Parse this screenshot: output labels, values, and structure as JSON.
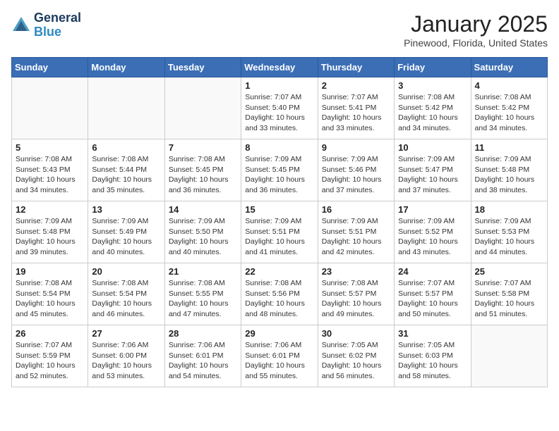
{
  "header": {
    "logo_line1": "General",
    "logo_line2": "Blue",
    "month": "January 2025",
    "location": "Pinewood, Florida, United States"
  },
  "days_of_week": [
    "Sunday",
    "Monday",
    "Tuesday",
    "Wednesday",
    "Thursday",
    "Friday",
    "Saturday"
  ],
  "weeks": [
    [
      {
        "day": "",
        "info": ""
      },
      {
        "day": "",
        "info": ""
      },
      {
        "day": "",
        "info": ""
      },
      {
        "day": "1",
        "info": "Sunrise: 7:07 AM\nSunset: 5:40 PM\nDaylight: 10 hours\nand 33 minutes."
      },
      {
        "day": "2",
        "info": "Sunrise: 7:07 AM\nSunset: 5:41 PM\nDaylight: 10 hours\nand 33 minutes."
      },
      {
        "day": "3",
        "info": "Sunrise: 7:08 AM\nSunset: 5:42 PM\nDaylight: 10 hours\nand 34 minutes."
      },
      {
        "day": "4",
        "info": "Sunrise: 7:08 AM\nSunset: 5:42 PM\nDaylight: 10 hours\nand 34 minutes."
      }
    ],
    [
      {
        "day": "5",
        "info": "Sunrise: 7:08 AM\nSunset: 5:43 PM\nDaylight: 10 hours\nand 34 minutes."
      },
      {
        "day": "6",
        "info": "Sunrise: 7:08 AM\nSunset: 5:44 PM\nDaylight: 10 hours\nand 35 minutes."
      },
      {
        "day": "7",
        "info": "Sunrise: 7:08 AM\nSunset: 5:45 PM\nDaylight: 10 hours\nand 36 minutes."
      },
      {
        "day": "8",
        "info": "Sunrise: 7:09 AM\nSunset: 5:45 PM\nDaylight: 10 hours\nand 36 minutes."
      },
      {
        "day": "9",
        "info": "Sunrise: 7:09 AM\nSunset: 5:46 PM\nDaylight: 10 hours\nand 37 minutes."
      },
      {
        "day": "10",
        "info": "Sunrise: 7:09 AM\nSunset: 5:47 PM\nDaylight: 10 hours\nand 37 minutes."
      },
      {
        "day": "11",
        "info": "Sunrise: 7:09 AM\nSunset: 5:48 PM\nDaylight: 10 hours\nand 38 minutes."
      }
    ],
    [
      {
        "day": "12",
        "info": "Sunrise: 7:09 AM\nSunset: 5:48 PM\nDaylight: 10 hours\nand 39 minutes."
      },
      {
        "day": "13",
        "info": "Sunrise: 7:09 AM\nSunset: 5:49 PM\nDaylight: 10 hours\nand 40 minutes."
      },
      {
        "day": "14",
        "info": "Sunrise: 7:09 AM\nSunset: 5:50 PM\nDaylight: 10 hours\nand 40 minutes."
      },
      {
        "day": "15",
        "info": "Sunrise: 7:09 AM\nSunset: 5:51 PM\nDaylight: 10 hours\nand 41 minutes."
      },
      {
        "day": "16",
        "info": "Sunrise: 7:09 AM\nSunset: 5:51 PM\nDaylight: 10 hours\nand 42 minutes."
      },
      {
        "day": "17",
        "info": "Sunrise: 7:09 AM\nSunset: 5:52 PM\nDaylight: 10 hours\nand 43 minutes."
      },
      {
        "day": "18",
        "info": "Sunrise: 7:09 AM\nSunset: 5:53 PM\nDaylight: 10 hours\nand 44 minutes."
      }
    ],
    [
      {
        "day": "19",
        "info": "Sunrise: 7:08 AM\nSunset: 5:54 PM\nDaylight: 10 hours\nand 45 minutes."
      },
      {
        "day": "20",
        "info": "Sunrise: 7:08 AM\nSunset: 5:54 PM\nDaylight: 10 hours\nand 46 minutes."
      },
      {
        "day": "21",
        "info": "Sunrise: 7:08 AM\nSunset: 5:55 PM\nDaylight: 10 hours\nand 47 minutes."
      },
      {
        "day": "22",
        "info": "Sunrise: 7:08 AM\nSunset: 5:56 PM\nDaylight: 10 hours\nand 48 minutes."
      },
      {
        "day": "23",
        "info": "Sunrise: 7:08 AM\nSunset: 5:57 PM\nDaylight: 10 hours\nand 49 minutes."
      },
      {
        "day": "24",
        "info": "Sunrise: 7:07 AM\nSunset: 5:57 PM\nDaylight: 10 hours\nand 50 minutes."
      },
      {
        "day": "25",
        "info": "Sunrise: 7:07 AM\nSunset: 5:58 PM\nDaylight: 10 hours\nand 51 minutes."
      }
    ],
    [
      {
        "day": "26",
        "info": "Sunrise: 7:07 AM\nSunset: 5:59 PM\nDaylight: 10 hours\nand 52 minutes."
      },
      {
        "day": "27",
        "info": "Sunrise: 7:06 AM\nSunset: 6:00 PM\nDaylight: 10 hours\nand 53 minutes."
      },
      {
        "day": "28",
        "info": "Sunrise: 7:06 AM\nSunset: 6:01 PM\nDaylight: 10 hours\nand 54 minutes."
      },
      {
        "day": "29",
        "info": "Sunrise: 7:06 AM\nSunset: 6:01 PM\nDaylight: 10 hours\nand 55 minutes."
      },
      {
        "day": "30",
        "info": "Sunrise: 7:05 AM\nSunset: 6:02 PM\nDaylight: 10 hours\nand 56 minutes."
      },
      {
        "day": "31",
        "info": "Sunrise: 7:05 AM\nSunset: 6:03 PM\nDaylight: 10 hours\nand 58 minutes."
      },
      {
        "day": "",
        "info": ""
      }
    ]
  ]
}
